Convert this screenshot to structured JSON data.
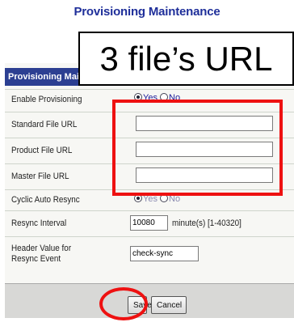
{
  "page_title": "Provisioning Maintenance",
  "callout_text": "3 file’s URL",
  "section_header": "Provisioning Maint",
  "rows": {
    "enable_provisioning": {
      "label": "Enable Provisioning",
      "options": [
        "Yes",
        "No"
      ],
      "selected": "Yes"
    },
    "standard_file_url": {
      "label": "Standard File URL",
      "value": ""
    },
    "product_file_url": {
      "label": "Product File URL",
      "value": ""
    },
    "master_file_url": {
      "label": "Master File URL",
      "value": ""
    },
    "cyclic_auto_resync": {
      "label": "Cyclic Auto Resync",
      "options": [
        "Yes",
        "No"
      ],
      "selected": "Yes"
    },
    "resync_interval": {
      "label": "Resync Interval",
      "value": "10080",
      "unit": "minute(s) [1-40320]"
    },
    "header_value": {
      "label": "Header Value for Resync Event",
      "value": "check-sync"
    }
  },
  "buttons": {
    "save": "Save",
    "cancel": "Cancel"
  },
  "colors": {
    "title": "#1f2f9a",
    "header_bg": "#2c3f92",
    "highlight": "#ee1111"
  }
}
